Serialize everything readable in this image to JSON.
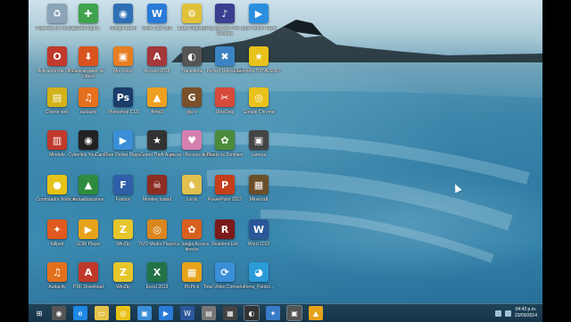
{
  "desktop": {
    "icons": [
      {
        "label": "Papelera de reciclaje",
        "icon": "recycle-bin-icon",
        "color": "#8aa4b8",
        "glyph": "♻"
      },
      {
        "label": "GetPlugins",
        "icon": "getplugins-icon",
        "color": "#3fa34d",
        "glyph": "✚"
      },
      {
        "label": "Google Earth",
        "icon": "google-earth-icon",
        "color": "#2f6fb5",
        "glyph": "◉"
      },
      {
        "label": "Wise Care 365",
        "icon": "wise-care-icon",
        "color": "#2a7bd8",
        "glyph": "W"
      },
      {
        "label": "Easy Registry",
        "icon": "registry-icon",
        "color": "#e0c23a",
        "glyph": "⚙"
      },
      {
        "label": "Reproductor Prin ... Recetas",
        "icon": "media-center-icon",
        "color": "#3a3f8f",
        "glyph": "♪"
      },
      {
        "label": "Total Video Player",
        "icon": "video-player-icon",
        "color": "#2a8fe0",
        "glyph": "▶"
      },
      {
        "label": "Activación de Office",
        "icon": "office-activation-icon",
        "color": "#c0392b",
        "glyph": "O"
      },
      {
        "label": "Descargador de Videos",
        "icon": "video-downloader-icon",
        "color": "#d9531e",
        "glyph": "⬇"
      },
      {
        "label": "Mis Fotos",
        "icon": "photos-icon",
        "color": "#e67e22",
        "glyph": "▣"
      },
      {
        "label": "Access 2013",
        "icon": "access-icon",
        "color": "#a4373a",
        "glyph": "A"
      },
      {
        "label": "Transitions",
        "icon": "transitions-icon",
        "color": "#555",
        "glyph": "◐"
      },
      {
        "label": "Perfect Uninstaller",
        "icon": "uninstaller-icon",
        "color": "#3b83c4",
        "glyph": "✖"
      },
      {
        "label": "Favoritos TOTALSOFT",
        "icon": "favorites-star-icon",
        "color": "#e8c21a",
        "glyph": "★"
      },
      {
        "label": "Cliente web",
        "icon": "web-client-icon",
        "color": "#d4b21a",
        "glyph": "▤"
      },
      {
        "label": "audacity",
        "icon": "audacity-icon",
        "color": "#e4701e",
        "glyph": "♫"
      },
      {
        "label": "Photoshop CS5",
        "icon": "photoshop-icon",
        "color": "#1b3d6b",
        "glyph": "Ps"
      },
      {
        "label": "Aimp3",
        "icon": "aimp-icon",
        "color": "#f0a020",
        "glyph": "▲"
      },
      {
        "label": "gta iv",
        "icon": "game-icon",
        "color": "#7a4f2a",
        "glyph": "G"
      },
      {
        "label": "UltraSnip",
        "icon": "snip-icon",
        "color": "#d64a3b",
        "glyph": "✂"
      },
      {
        "label": "Google Chrome",
        "icon": "chrome-icon",
        "color": "#e8c21a",
        "glyph": "◎"
      },
      {
        "label": "Mindefe",
        "icon": "mindefe-icon",
        "color": "#c0392b",
        "glyph": "▥"
      },
      {
        "label": "Cyberlink YouCam 5",
        "icon": "webcam-icon",
        "color": "#222",
        "glyph": "◉"
      },
      {
        "label": "Free Online Player",
        "icon": "online-player-icon",
        "color": "#3a8fd8",
        "glyph": "▶"
      },
      {
        "label": "Grand Theft Auto",
        "icon": "gta-icon",
        "color": "#333",
        "glyph": "★"
      },
      {
        "label": "gta sa - Acceso directo",
        "icon": "gta-sa-icon",
        "color": "#d67fb0",
        "glyph": "♥"
      },
      {
        "label": "Plants vs Zombies",
        "icon": "plants-icon",
        "color": "#4b8b3b",
        "glyph": "✿"
      },
      {
        "label": "camera",
        "icon": "camera-icon",
        "color": "#444",
        "glyph": "▣"
      },
      {
        "label": "Controlador Webcam",
        "icon": "webcam-driver-icon",
        "color": "#e6c318",
        "glyph": "●"
      },
      {
        "label": "Actualizaciones",
        "icon": "updates-icon",
        "color": "#2e8b3e",
        "glyph": "▲"
      },
      {
        "label": "Funbox",
        "icon": "funbox-icon",
        "color": "#2f5fa8",
        "glyph": "F"
      },
      {
        "label": "Monkey Island",
        "icon": "monkey-icon",
        "color": "#8c2d22",
        "glyph": "☠"
      },
      {
        "label": "Lords",
        "icon": "lords-icon",
        "color": "#e1c050",
        "glyph": "♞"
      },
      {
        "label": "PowerPoint 2013",
        "icon": "powerpoint-icon",
        "color": "#c43e1c",
        "glyph": "P"
      },
      {
        "label": "Minecraft",
        "icon": "minecraft-icon",
        "color": "#6b4f2a",
        "glyph": "▦"
      },
      {
        "label": "fallpvd",
        "icon": "fox-icon",
        "color": "#e05a1f",
        "glyph": "✦"
      },
      {
        "label": "GOM Player",
        "icon": "gom-player-icon",
        "color": "#e6a21a",
        "glyph": "▶"
      },
      {
        "label": "WinZip",
        "icon": "winzip-icon",
        "color": "#e6c62a",
        "glyph": "Z"
      },
      {
        "label": "DVD Media Player",
        "icon": "dvd-player-icon",
        "color": "#d9861e",
        "glyph": "◎"
      },
      {
        "label": "La Jungla Acceso directo",
        "icon": "jungle-icon",
        "color": "#d8601e",
        "glyph": "✿"
      },
      {
        "label": "Resident Evil",
        "icon": "resident-evil-icon",
        "color": "#7a1a1a",
        "glyph": "R"
      },
      {
        "label": "Word 2013",
        "icon": "word-icon",
        "color": "#2b579a",
        "glyph": "W"
      },
      {
        "label": "Audacity",
        "icon": "audacity-alt-icon",
        "color": "#e4701e",
        "glyph": "♫"
      },
      {
        "label": "PDF Download",
        "icon": "pdf-icon",
        "color": "#c0392b",
        "glyph": "A"
      },
      {
        "label": "WinZip",
        "icon": "winzip-alt-icon",
        "color": "#e6c62a",
        "glyph": "Z"
      },
      {
        "label": "Excel 2013",
        "icon": "excel-icon",
        "color": "#217346",
        "glyph": "X"
      },
      {
        "label": "PicPick",
        "icon": "picpick-icon",
        "color": "#e8a21a",
        "glyph": "▦"
      },
      {
        "label": "Total Video Converter",
        "icon": "video-converter-icon",
        "color": "#3b8fd8",
        "glyph": "⟳"
      },
      {
        "label": "Foros_Peticio...",
        "icon": "forums-icon",
        "color": "#2a9bd8",
        "glyph": "◕"
      }
    ]
  },
  "taskbar": {
    "start_label": "⊞",
    "items": [
      {
        "icon": "camera-app-icon",
        "glyph": "◉",
        "color": "#555"
      },
      {
        "icon": "browser-icon",
        "glyph": "e",
        "color": "#1e88e5"
      },
      {
        "icon": "folder-icon",
        "glyph": "▭",
        "color": "#e6c24a"
      },
      {
        "icon": "chrome-task-icon",
        "glyph": "◎",
        "color": "#e8c21a"
      },
      {
        "icon": "photos-task-icon",
        "glyph": "▣",
        "color": "#3a8fd8"
      },
      {
        "icon": "media-task-icon",
        "glyph": "▶",
        "color": "#2a7bd8"
      },
      {
        "icon": "word-task-icon",
        "glyph": "W",
        "color": "#2b579a"
      },
      {
        "icon": "window-task-icon",
        "glyph": "▤",
        "color": "#777"
      },
      {
        "icon": "capture-task-icon",
        "glyph": "▦",
        "color": "#444"
      },
      {
        "icon": "app-task-icon",
        "glyph": "◐",
        "color": "#333"
      },
      {
        "icon": "tools-task-icon",
        "glyph": "✦",
        "color": "#3a7bc8"
      },
      {
        "icon": "editor-task-icon",
        "glyph": "▣",
        "color": "#555"
      },
      {
        "icon": "game-task-icon",
        "glyph": "▲",
        "color": "#e6a21a"
      }
    ],
    "clock": {
      "time": "04:42 p.m.",
      "date": "23/09/2014"
    }
  }
}
